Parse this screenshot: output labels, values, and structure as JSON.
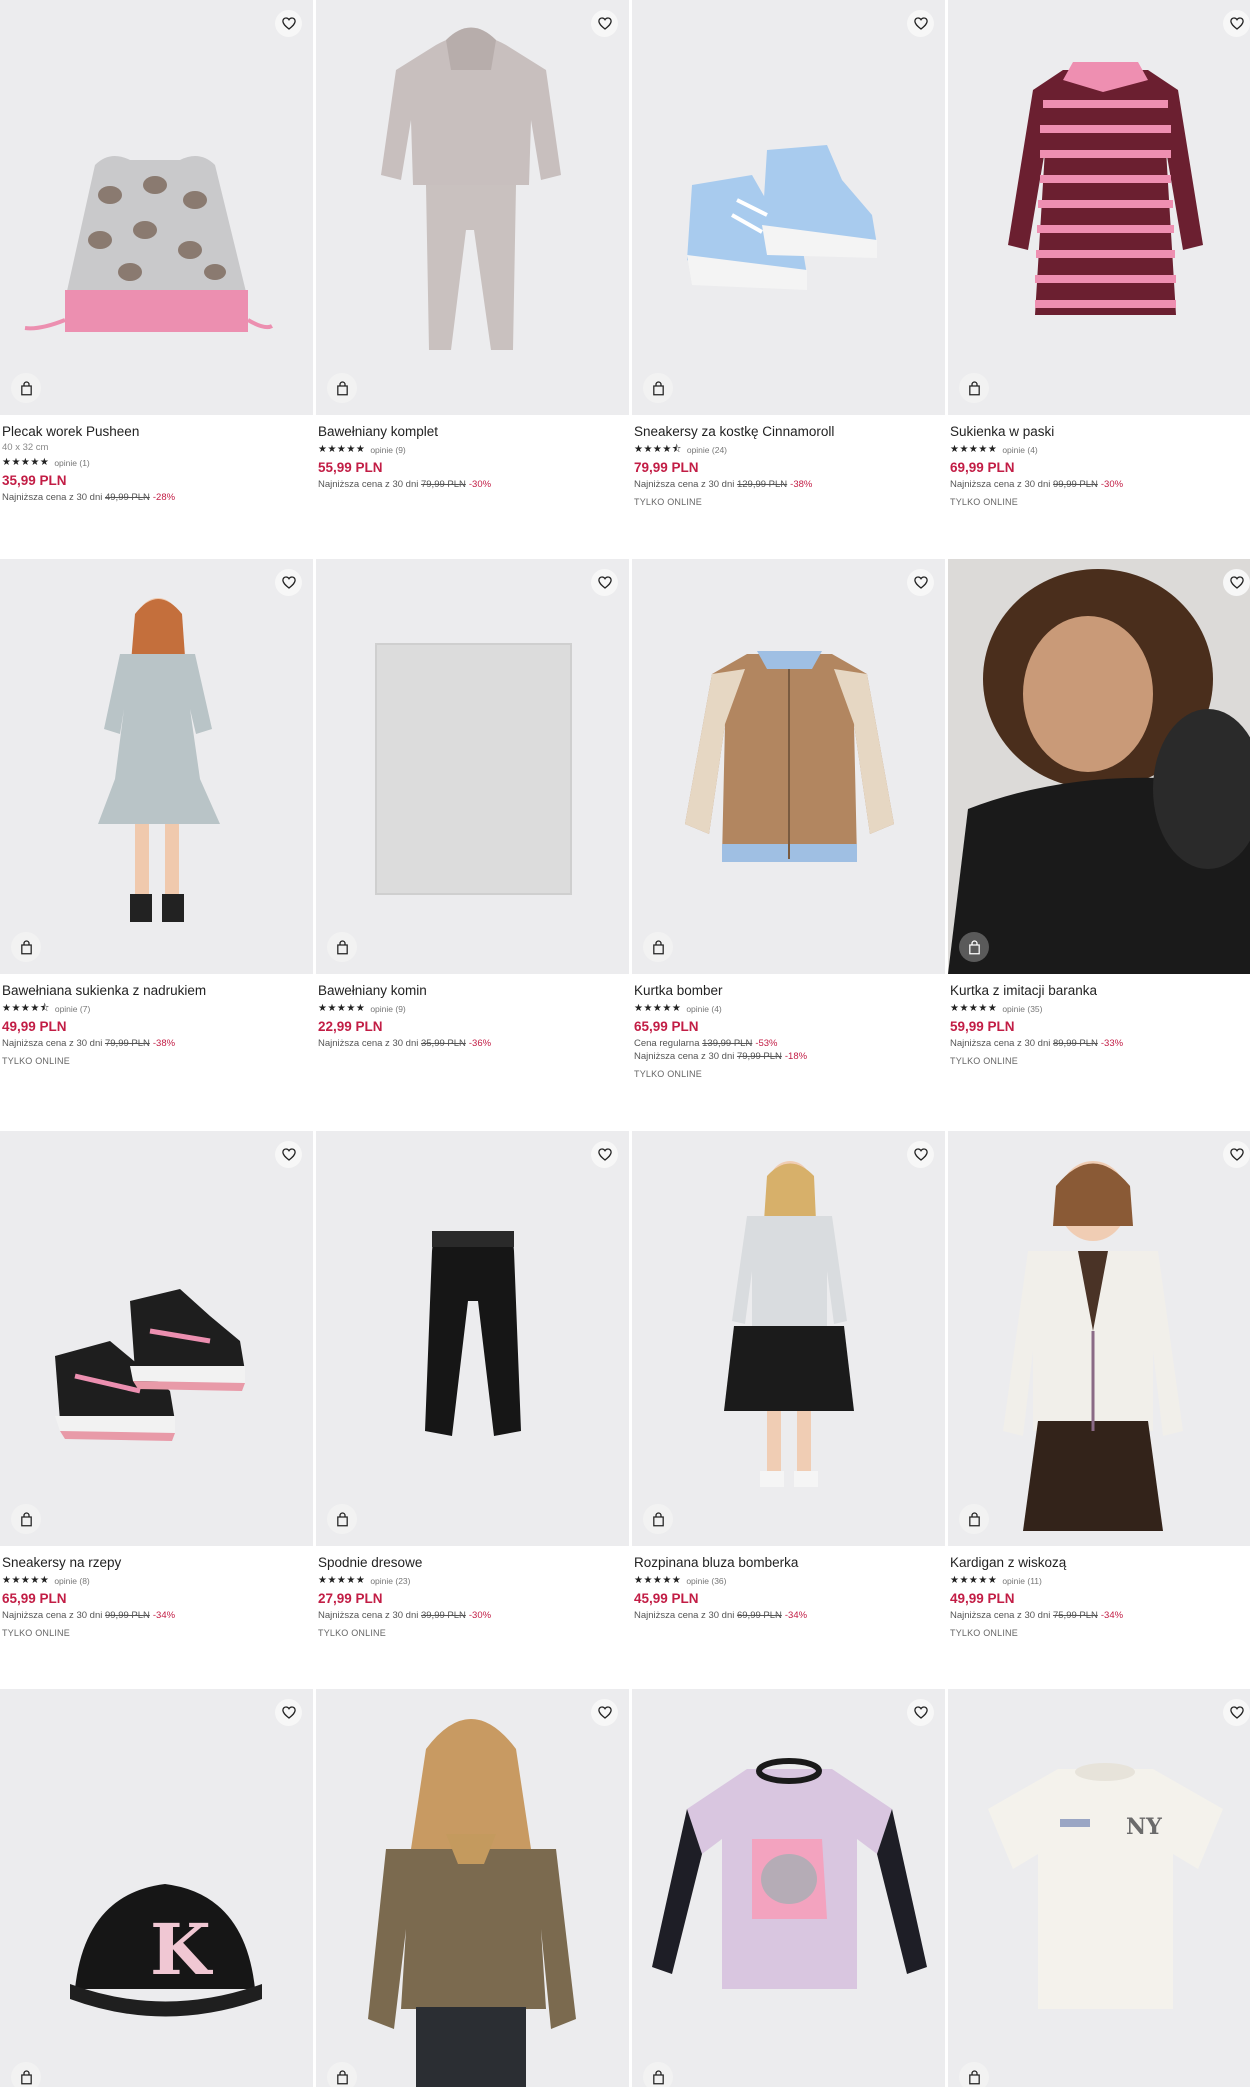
{
  "colors": {
    "price": "#c21d45",
    "imageBg": "#ececee",
    "favBg": "#f7f7f7"
  },
  "icons": {
    "favorite": "heart-icon",
    "cart": "shopping-bag-icon"
  },
  "products": [
    {
      "name": "Plecak worek Pusheen",
      "size": "40 x 32 cm",
      "stars": "★★★★★",
      "reviews": "opinie (1)",
      "price": "35,99 PLN",
      "lowest_label": "Najniższa cena z 30 dni",
      "lowest_old": "49,99 PLN",
      "lowest_disc": "-28%"
    },
    {
      "name": "Bawełniany komplet",
      "stars": "★★★★★",
      "reviews": "opinie (9)",
      "price": "55,99 PLN",
      "lowest_label": "Najniższa cena z 30 dni",
      "lowest_old": "79,99 PLN",
      "lowest_disc": "-30%"
    },
    {
      "name": "Sneakersy za kostkę Cinnamoroll",
      "stars": "★★★★⯪",
      "reviews": "opinie (24)",
      "price": "79,99 PLN",
      "lowest_label": "Najniższa cena z 30 dni",
      "lowest_old": "129,99 PLN",
      "lowest_disc": "-38%",
      "online": "TYLKO ONLINE"
    },
    {
      "name": "Sukienka w paski",
      "stars": "★★★★★",
      "reviews": "opinie (4)",
      "price": "69,99 PLN",
      "lowest_label": "Najniższa cena z 30 dni",
      "lowest_old": "99,99 PLN",
      "lowest_disc": "-30%",
      "online": "TYLKO ONLINE"
    },
    {
      "name": "Bawełniana sukienka z nadrukiem",
      "stars": "★★★★⯪",
      "reviews": "opinie (7)",
      "price": "49,99 PLN",
      "lowest_label": "Najniższa cena z 30 dni",
      "lowest_old": "79,99 PLN",
      "lowest_disc": "-38%",
      "online": "TYLKO ONLINE"
    },
    {
      "name": "Bawełniany komin",
      "stars": "★★★★★",
      "reviews": "opinie (9)",
      "price": "22,99 PLN",
      "lowest_label": "Najniższa cena z 30 dni",
      "lowest_old": "35,99 PLN",
      "lowest_disc": "-36%"
    },
    {
      "name": "Kurtka bomber",
      "stars": "★★★★★",
      "reviews": "opinie (4)",
      "price": "65,99 PLN",
      "regular_label": "Cena regularna",
      "regular_old": "139,99 PLN",
      "regular_disc": "-53%",
      "lowest_label": "Najniższa cena z 30 dni",
      "lowest_old": "79,99 PLN",
      "lowest_disc": "-18%",
      "online": "TYLKO ONLINE"
    },
    {
      "name": "Kurtka z imitacji baranka",
      "stars": "★★★★★",
      "reviews": "opinie (35)",
      "price": "59,99 PLN",
      "lowest_label": "Najniższa cena z 30 dni",
      "lowest_old": "89,99 PLN",
      "lowest_disc": "-33%",
      "online": "TYLKO ONLINE"
    },
    {
      "name": "Sneakersy na rzepy",
      "stars": "★★★★★",
      "reviews": "opinie (8)",
      "price": "65,99 PLN",
      "lowest_label": "Najniższa cena z 30 dni",
      "lowest_old": "99,99 PLN",
      "lowest_disc": "-34%",
      "online": "TYLKO ONLINE"
    },
    {
      "name": "Spodnie dresowe",
      "stars": "★★★★★",
      "reviews": "opinie (23)",
      "price": "27,99 PLN",
      "lowest_label": "Najniższa cena z 30 dni",
      "lowest_old": "39,99 PLN",
      "lowest_disc": "-30%",
      "online": "TYLKO ONLINE"
    },
    {
      "name": "Rozpinana bluza bomberka",
      "stars": "★★★★★",
      "reviews": "opinie (36)",
      "price": "45,99 PLN",
      "lowest_label": "Najniższa cena z 30 dni",
      "lowest_old": "69,99 PLN",
      "lowest_disc": "-34%"
    },
    {
      "name": "Kardigan z wiskozą",
      "stars": "★★★★★",
      "reviews": "opinie (11)",
      "price": "49,99 PLN",
      "lowest_label": "Najniższa cena z 30 dni",
      "lowest_old": "75,99 PLN",
      "lowest_disc": "-34%",
      "online": "TYLKO ONLINE"
    },
    {
      "name": "",
      "stars": "",
      "reviews": "",
      "price": "",
      "lowest_label": ""
    },
    {
      "name": "",
      "stars": "",
      "reviews": "",
      "price": "",
      "lowest_label": ""
    },
    {
      "name": "",
      "stars": "",
      "reviews": "",
      "price": "",
      "lowest_label": ""
    },
    {
      "name": "",
      "stars": "",
      "reviews": "",
      "price": "",
      "lowest_label": ""
    }
  ]
}
